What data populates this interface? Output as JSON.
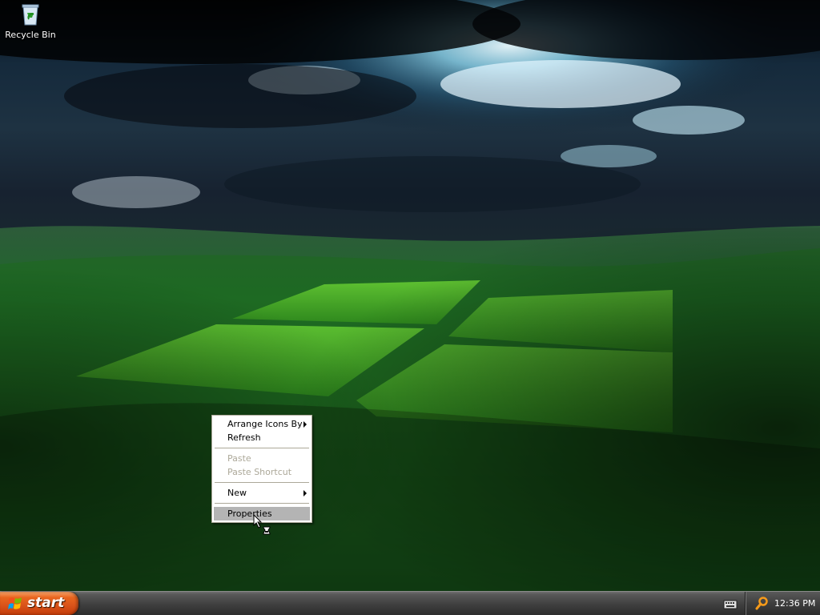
{
  "desktop": {
    "icons": [
      {
        "label": "Recycle Bin",
        "icon": "recycle-bin-icon"
      }
    ]
  },
  "context_menu": {
    "items": [
      {
        "label": "Arrange Icons By",
        "enabled": true,
        "submenu": true
      },
      {
        "label": "Refresh",
        "enabled": true,
        "submenu": false
      },
      {
        "label": "Paste",
        "enabled": false,
        "submenu": false
      },
      {
        "label": "Paste Shortcut",
        "enabled": false,
        "submenu": false
      },
      {
        "label": "New",
        "enabled": true,
        "submenu": true
      },
      {
        "label": "Properties",
        "enabled": true,
        "submenu": false,
        "selected": true
      }
    ]
  },
  "taskbar": {
    "start_label": "start",
    "clock": "12:36 PM",
    "tray_icons": [
      "keyboard-icon",
      "search-icon"
    ]
  },
  "colors": {
    "start_button": "#e0581c",
    "taskbar": "#3f3f3f",
    "menu_highlight": "#b4b4b4",
    "menu_disabled_text": "#aca899"
  }
}
